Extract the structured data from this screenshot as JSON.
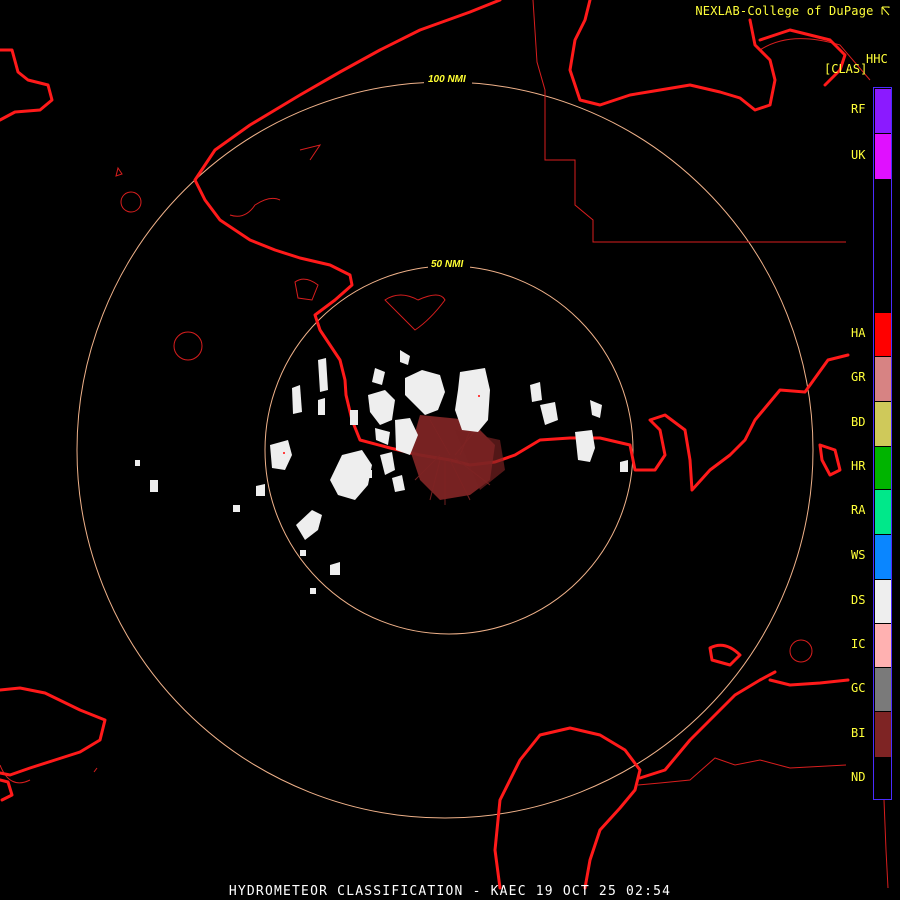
{
  "header": {
    "credit": "NEXLAB-College of DuPage",
    "credit_icon": "resize-corner-icon"
  },
  "product": {
    "code": "HHC",
    "label": "[CLAS]"
  },
  "rings": [
    {
      "label": "100 NMI"
    },
    {
      "label": "50 NMI"
    }
  ],
  "legend": {
    "classes": [
      {
        "label": "RF",
        "color": "#8b1aff"
      },
      {
        "label": "UK",
        "color": "#e010ff"
      },
      {
        "label": "HA",
        "color": "#ff0000"
      },
      {
        "label": "GR",
        "color": "#d78383"
      },
      {
        "label": "BD",
        "color": "#cfc95a"
      },
      {
        "label": "HR",
        "color": "#00b400"
      },
      {
        "label": "RA",
        "color": "#00e88a"
      },
      {
        "label": "WS",
        "color": "#0a86ff"
      },
      {
        "label": "DS",
        "color": "#eeeeee"
      },
      {
        "label": "IC",
        "color": "#ffb1b1"
      },
      {
        "label": "GC",
        "color": "#7a7a7a"
      },
      {
        "label": "BI",
        "color": "#7e2424"
      },
      {
        "label": "ND",
        "color": "#000000"
      }
    ]
  },
  "colors": {
    "coastline": "#ff1a1a",
    "boundary": "#d81e1e",
    "range_ring": "#f0b28a",
    "dry_snow": "#eeeeee",
    "biological": "#7e2424",
    "text": "#ffff3a"
  },
  "caption": "HYDROMETEOR CLASSIFICATION - KAEC 19 OCT 25 02:54"
}
